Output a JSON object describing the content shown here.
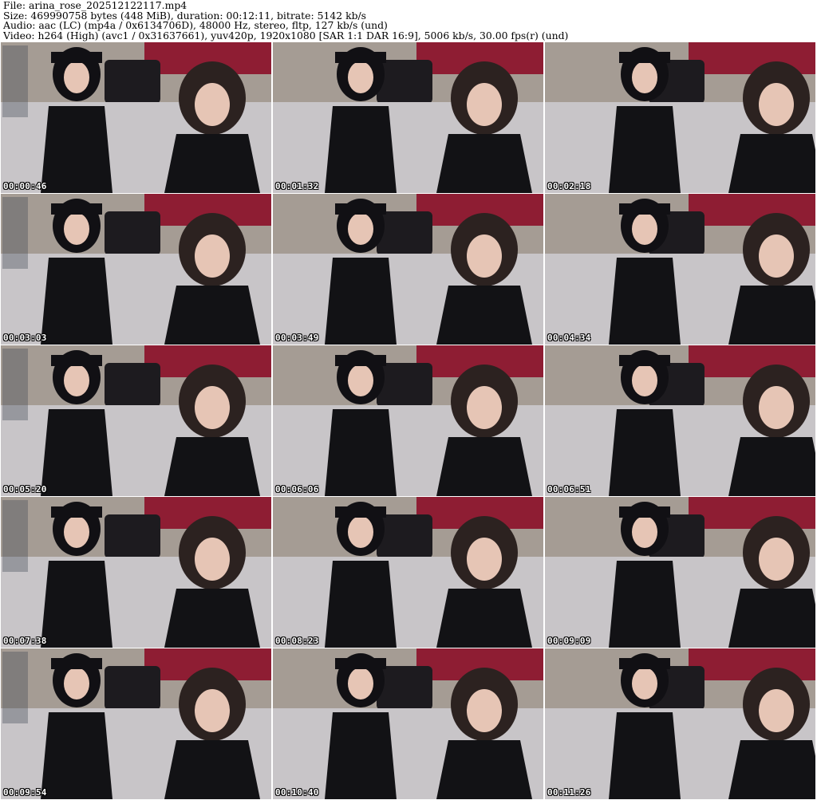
{
  "header": {
    "line1": "File: arina_rose_202512122117.mp4",
    "line2": "Size: 469990758 bytes (448 MiB), duration: 00:12:11, bitrate: 5142 kb/s",
    "line3": "Audio: aac (LC) (mp4a / 0x6134706D), 48000 Hz, stereo, fltp, 127 kb/s (und)",
    "line4": "Video: h264 (High) (avc1 / 0x31637661), yuv420p, 1920x1080 [SAR 1:1 DAR 16:9], 5006 kb/s, 30.00 fps(r) (und)"
  },
  "thumbnails": [
    {
      "time": "00:00:46"
    },
    {
      "time": "00:01:32"
    },
    {
      "time": "00:02:18"
    },
    {
      "time": "00:03:03"
    },
    {
      "time": "00:03:49"
    },
    {
      "time": "00:04:34"
    },
    {
      "time": "00:05:20"
    },
    {
      "time": "00:06:06"
    },
    {
      "time": "00:06:51"
    },
    {
      "time": "00:07:38"
    },
    {
      "time": "00:08:23"
    },
    {
      "time": "00:09:09"
    },
    {
      "time": "00:09:54"
    },
    {
      "time": "00:10:40"
    },
    {
      "time": "00:11:26"
    }
  ],
  "colors": {
    "wall": "#a59c94",
    "bed": "#c8c5c8",
    "curtain": "#8e1d33",
    "hair": "#111014",
    "skin": "#e6c5b5",
    "clothing": "#121215"
  }
}
